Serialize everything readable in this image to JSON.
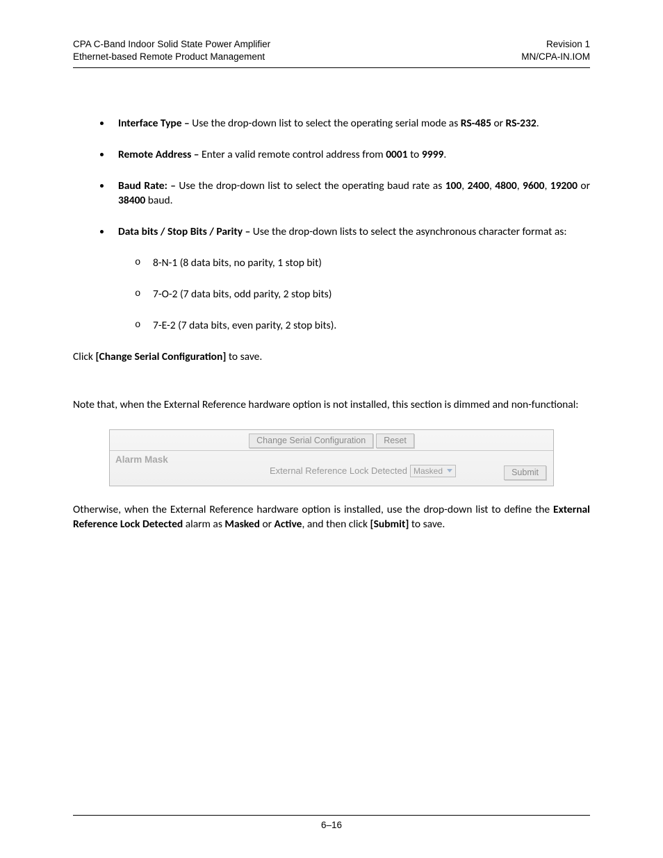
{
  "header": {
    "left1": "CPA C-Band Indoor Solid State Power Amplifier",
    "left2": "Ethernet-based Remote Product Management",
    "right1": "Revision 1",
    "right2": "MN/CPA-IN.IOM"
  },
  "bullets": {
    "interface": {
      "label": "Interface Type –",
      "text1": " Use the drop-down list to select the operating serial mode as ",
      "b1": "RS-485",
      "or": " or ",
      "b2": "RS-232",
      "end": "."
    },
    "remote": {
      "label": "Remote Address –",
      "text1": " Enter a valid remote control address from ",
      "b1": "0001",
      "to": " to ",
      "b2": "9999",
      "end": "."
    },
    "baud": {
      "label": "Baud Rate: –",
      "text1": " Use the drop-down list to select the operating baud rate as ",
      "b1": "100",
      "c1": ", ",
      "b2": "2400",
      "c2": ", ",
      "b3": "4800",
      "c3": ", ",
      "b4": "9600",
      "c4": ", ",
      "b5": "19200",
      "or": " or ",
      "b6": "38400",
      "end": " baud."
    },
    "databits": {
      "label": "Data bits / Stop Bits / Parity –",
      "text": " Use the drop-down lists to select the asynchronous character format as:",
      "sub1": "8-N-1 (8 data bits, no parity, 1 stop bit)",
      "sub2": "7-O-2 (7 data bits, odd parity, 2 stop bits)",
      "sub3": "7-E-2 (7 data bits, even parity, 2 stop bits)."
    }
  },
  "p1": {
    "a": "Click ",
    "b": "[Change Serial Configuration]",
    "c": " to save."
  },
  "p2": "Note that, when the External Reference hardware option is not installed, this section is dimmed and non-functional:",
  "figure": {
    "btn_change": "Change Serial Configuration",
    "btn_reset": "Reset",
    "section_label": "Alarm Mask",
    "field_label": "External Reference Lock Detected",
    "select_value": "Masked",
    "btn_submit": "Submit"
  },
  "p3": {
    "a": "Otherwise, when the External Reference hardware option is installed, use the drop-down list to define the ",
    "b1": "External Reference Lock Detected",
    "c": " alarm as ",
    "b2": "Masked",
    "d": " or ",
    "b3": "Active",
    "e": ", and then click ",
    "b4": "[Submit]",
    "f": " to save."
  },
  "footer": "6–16"
}
